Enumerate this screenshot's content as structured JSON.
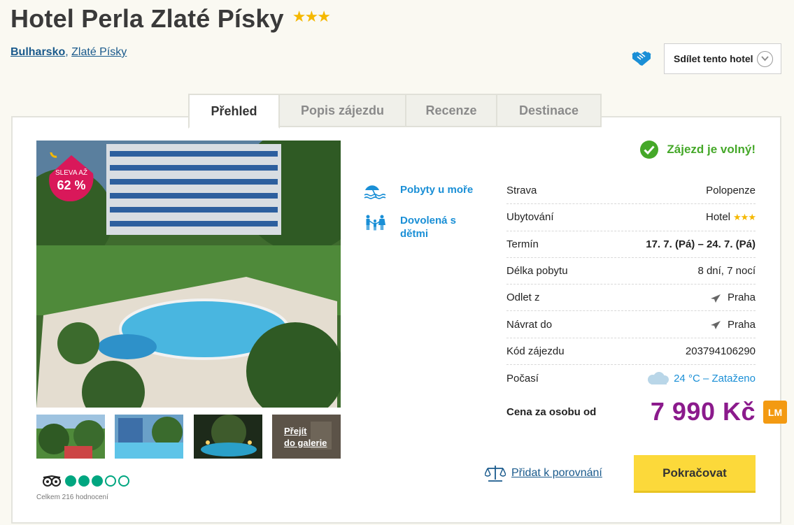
{
  "hotel": {
    "name": "Hotel Perla Zlaté Písky",
    "stars": "★★★"
  },
  "breadcrumb": {
    "country": "Bulharsko",
    "separator": ",",
    "city": "Zlaté Písky"
  },
  "share": {
    "label": "Sdílet tento hotel",
    "icon": "handshake-icon"
  },
  "tabs": [
    {
      "label": "Přehled",
      "active": true
    },
    {
      "label": "Popis zájezdu",
      "active": false
    },
    {
      "label": "Recenze",
      "active": false
    },
    {
      "label": "Destinace",
      "active": false
    }
  ],
  "gallery": {
    "sale_line1": "SLEVA AŽ",
    "sale_line2": "62 %",
    "gallery_link_line1": "Přejít",
    "gallery_link_line2": "do galerie"
  },
  "tripadvisor": {
    "rating": 3,
    "max": 5,
    "count_text": "Celkem 216 hodnocení"
  },
  "categories": [
    {
      "label": "Pobyty u moře",
      "icon": "beach-umbrella-icon"
    },
    {
      "label": "Dovolená s dětmi",
      "icon": "family-icon"
    }
  ],
  "availability": {
    "text": "Zájezd je volný!"
  },
  "info": [
    {
      "label": "Strava",
      "value": "Polopenze"
    },
    {
      "label": "Ubytování",
      "value": "Hotel",
      "stars": "★★★"
    },
    {
      "label": "Termín",
      "value": "17. 7. (Pá) – 24. 7. (Pá)"
    },
    {
      "label": "Délka pobytu",
      "value": "8 dní, 7 nocí"
    },
    {
      "label": "Odlet z",
      "value": "Praha"
    },
    {
      "label": "Návrat do",
      "value": "Praha"
    },
    {
      "label": "Kód zájezdu",
      "value": "203794106290"
    },
    {
      "label": "Počasí",
      "value": "24 °C – Zataženo"
    }
  ],
  "price": {
    "label": "Cena za osobu od",
    "value": "7 990 Kč",
    "badge": "LM"
  },
  "actions": {
    "compare": "Přidat k porovnání",
    "continue": "Pokračovat"
  },
  "colors": {
    "price": "#8b1a8c",
    "available": "#45a829",
    "link": "#1a8fd6",
    "button": "#fcd93a",
    "badge": "#f39a12"
  }
}
